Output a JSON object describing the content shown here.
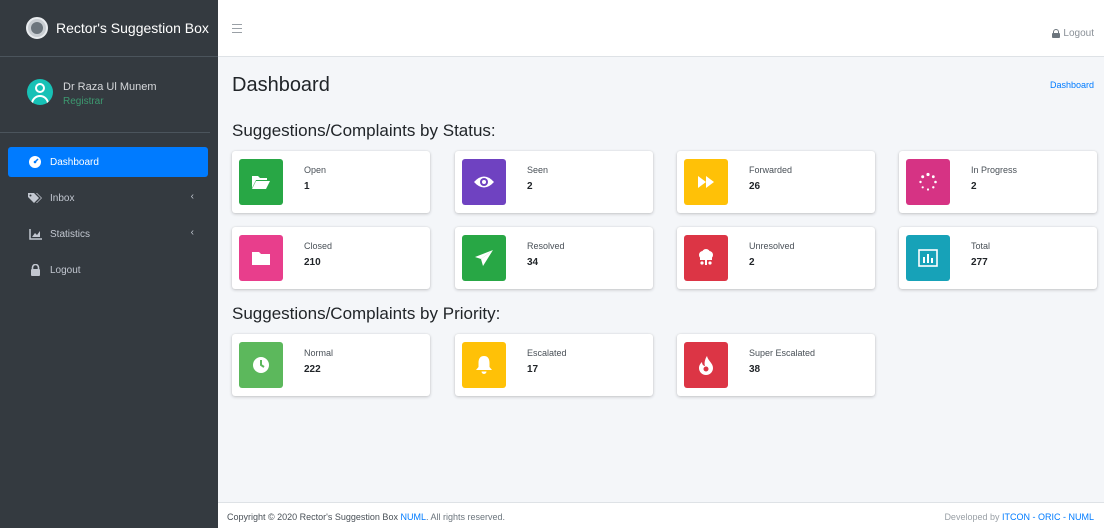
{
  "brand": {
    "title": "Rector's Suggestion Box"
  },
  "user": {
    "name": "Dr Raza Ul Munem",
    "role": "Registrar"
  },
  "sidebar": {
    "items": [
      {
        "label": "Dashboard",
        "icon": "dashboard-icon"
      },
      {
        "label": "Inbox",
        "icon": "inbox-tags-icon"
      },
      {
        "label": "Statistics",
        "icon": "chart-area-icon"
      },
      {
        "label": "Logout",
        "icon": "lock-icon"
      }
    ]
  },
  "topbar": {
    "logout": "Logout"
  },
  "page": {
    "title": "Dashboard",
    "breadcrumb": "Dashboard"
  },
  "status": {
    "title": "Suggestions/Complaints by Status:",
    "boxes": [
      {
        "label": "Open",
        "value": "1",
        "color": "#28a745",
        "icon": "folder-open-icon"
      },
      {
        "label": "Seen",
        "value": "2",
        "color": "#6f42c1",
        "icon": "eye-icon"
      },
      {
        "label": "Forwarded",
        "value": "26",
        "color": "#ffc107",
        "icon": "forward-icon"
      },
      {
        "label": "In Progress",
        "value": "2",
        "color": "#d63384",
        "icon": "spinner-icon"
      },
      {
        "label": "Closed",
        "value": "210",
        "color": "#e83e8c",
        "icon": "folder-icon"
      },
      {
        "label": "Resolved",
        "value": "34",
        "color": "#28a745",
        "icon": "paper-plane-icon"
      },
      {
        "label": "Unresolved",
        "value": "2",
        "color": "#dc3545",
        "icon": "bug-icon"
      },
      {
        "label": "Total",
        "value": "277",
        "color": "#17a2b8",
        "icon": "bar-chart-icon"
      }
    ]
  },
  "priority": {
    "title": "Suggestions/Complaints by Priority:",
    "boxes": [
      {
        "label": "Normal",
        "value": "222",
        "color": "#5cb85c",
        "icon": "clock-icon"
      },
      {
        "label": "Escalated",
        "value": "17",
        "color": "#ffc107",
        "icon": "bell-icon"
      },
      {
        "label": "Super Escalated",
        "value": "38",
        "color": "#dc3545",
        "icon": "fire-icon"
      }
    ]
  },
  "footer": {
    "copyright": "Copyright © 2020 Rector's Suggestion Box",
    "org": "NUML",
    "rights": ". All rights reserved.",
    "developed_by": "Developed by",
    "dev_link": "ITCON - ORIC - NUML"
  }
}
